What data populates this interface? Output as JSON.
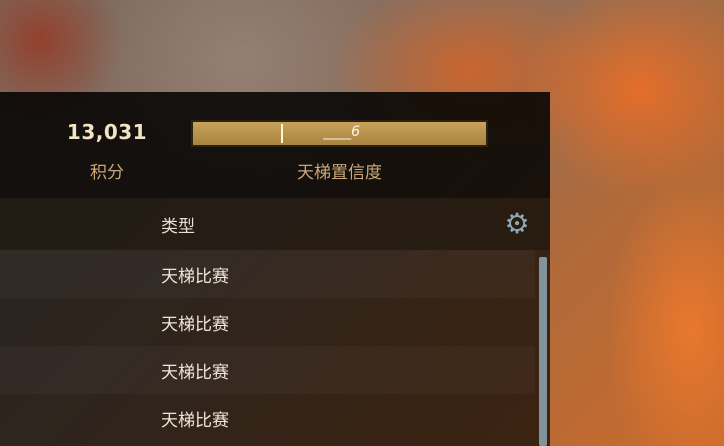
{
  "stats": {
    "score_value": "13,031",
    "score_label": "积分",
    "confidence_label": "天梯置信度",
    "confidence_progress_percent": 100,
    "confidence_bar_text": "____6"
  },
  "table": {
    "type_header": "类型",
    "rows": [
      "天梯比赛",
      "天梯比赛",
      "天梯比赛",
      "天梯比赛"
    ]
  },
  "icons": {
    "settings": "gear-icon"
  },
  "colors": {
    "accent_gold": "#c9a35a",
    "label_tan": "#caa878",
    "scrollbar": "#96afbe"
  }
}
